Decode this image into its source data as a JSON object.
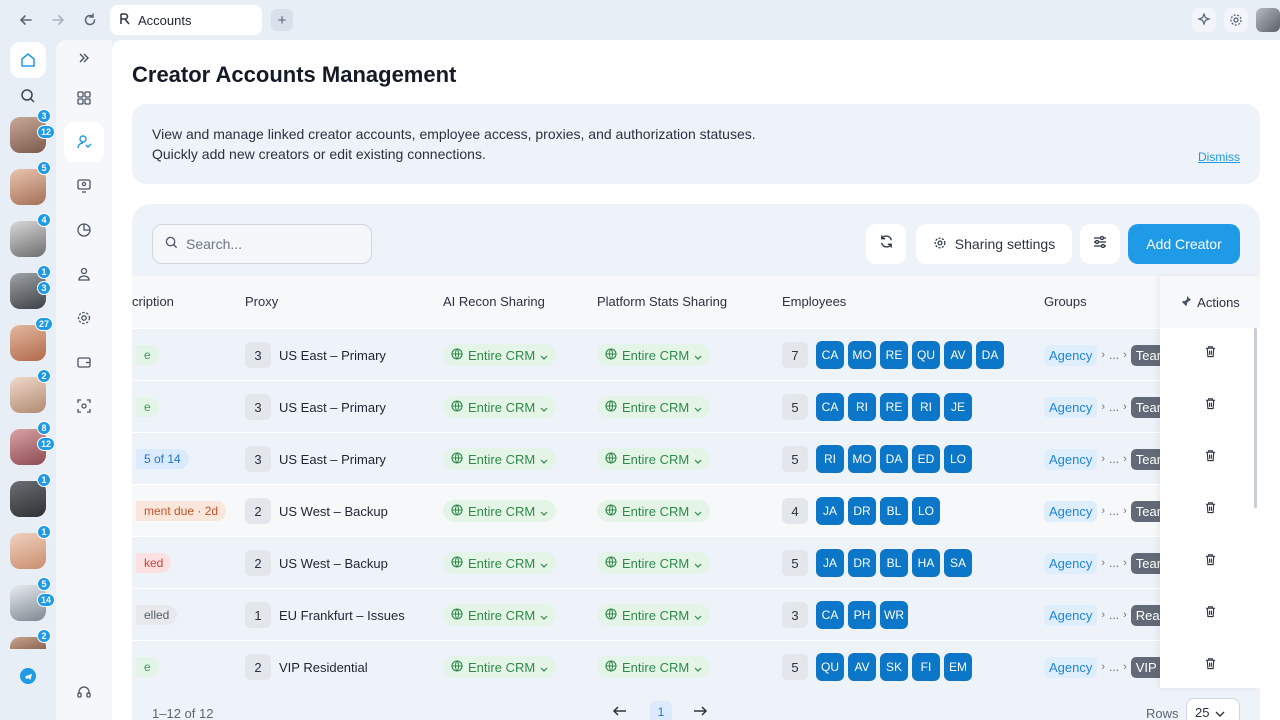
{
  "browser": {
    "tab_title": "Accounts",
    "new_tab": "+"
  },
  "rail_creators": [
    {
      "badges": [
        "3",
        "12"
      ]
    },
    {
      "badges": [
        "5"
      ]
    },
    {
      "badges": [
        "4"
      ]
    },
    {
      "badges": [
        "1",
        "3"
      ]
    },
    {
      "badges": [
        "27"
      ]
    },
    {
      "badges": [
        "2"
      ]
    },
    {
      "badges": [
        "8",
        "12"
      ]
    },
    {
      "badges": [
        "1"
      ]
    },
    {
      "badges": [
        "1"
      ]
    },
    {
      "badges": [
        "5",
        "14"
      ]
    },
    {
      "badges": [
        "2"
      ]
    }
  ],
  "page": {
    "title": "Creator Accounts Management",
    "info_line1": "View and manage linked creator accounts, employee access, proxies, and authorization statuses.",
    "info_line2": "Quickly add new creators or edit existing connections.",
    "dismiss": "Dismiss"
  },
  "toolbar": {
    "search_placeholder": "Search...",
    "sharing_settings": "Sharing settings",
    "add_creator": "Add Creator"
  },
  "table": {
    "headers": {
      "subscription": "cription",
      "proxy": "Proxy",
      "ai_recon": "AI Recon Sharing",
      "platform_stats": "Platform Stats Sharing",
      "employees": "Employees",
      "groups": "Groups",
      "actions": "Actions"
    },
    "rows": [
      {
        "status": "e",
        "status_color": "green",
        "proxy_count": "3",
        "proxy_name": "US East – Primary",
        "ai": "Entire CRM",
        "stats": "Entire CRM",
        "emp_count": "7",
        "emps": [
          "CA",
          "MO",
          "RE",
          "QU",
          "AV",
          "DA"
        ],
        "group": "Agency",
        "group_more": "...",
        "tag": "Team"
      },
      {
        "status": "e",
        "status_color": "green",
        "proxy_count": "3",
        "proxy_name": "US East – Primary",
        "ai": "Entire CRM",
        "stats": "Entire CRM",
        "emp_count": "5",
        "emps": [
          "CA",
          "RI",
          "RE",
          "RI",
          "JE"
        ],
        "group": "Agency",
        "group_more": "...",
        "tag": "Team"
      },
      {
        "status": "5 of 14",
        "status_color": "blue",
        "proxy_count": "3",
        "proxy_name": "US East – Primary",
        "ai": "Entire CRM",
        "stats": "Entire CRM",
        "emp_count": "5",
        "emps": [
          "RI",
          "MO",
          "DA",
          "ED",
          "LO"
        ],
        "group": "Agency",
        "group_more": "...",
        "tag": "Team"
      },
      {
        "status": "ment due · 2d",
        "status_color": "orange",
        "proxy_count": "2",
        "proxy_name": "US West – Backup",
        "ai": "Entire CRM",
        "stats": "Entire CRM",
        "emp_count": "4",
        "emps": [
          "JA",
          "DR",
          "BL",
          "LO"
        ],
        "group": "Agency",
        "group_more": "...",
        "tag": "Team"
      },
      {
        "status": "ked",
        "status_color": "red",
        "proxy_count": "2",
        "proxy_name": "US West – Backup",
        "ai": "Entire CRM",
        "stats": "Entire CRM",
        "emp_count": "5",
        "emps": [
          "JA",
          "DR",
          "BL",
          "HA",
          "SA"
        ],
        "group": "Agency",
        "group_more": "...",
        "tag": "Team"
      },
      {
        "status": "elled",
        "status_color": "gray",
        "proxy_count": "1",
        "proxy_name": "EU Frankfurt – Issues",
        "ai": "Entire CRM",
        "stats": "Entire CRM",
        "emp_count": "3",
        "emps": [
          "CA",
          "PH",
          "WR"
        ],
        "group": "Agency",
        "group_more": "...",
        "tag": "React"
      },
      {
        "status": "e",
        "status_color": "green",
        "proxy_count": "2",
        "proxy_name": "VIP Residential",
        "ai": "Entire CRM",
        "stats": "Entire CRM",
        "emp_count": "5",
        "emps": [
          "QU",
          "AV",
          "SK",
          "FI",
          "EM"
        ],
        "group": "Agency",
        "group_more": "...",
        "tag": "VIP P"
      }
    ]
  },
  "footer": {
    "range": "1–12 of 12",
    "page": "1",
    "rows_label": "Rows",
    "rows_value": "25"
  },
  "colors": {
    "accent": "#1e9ae6",
    "chip": "#0c76c8"
  }
}
